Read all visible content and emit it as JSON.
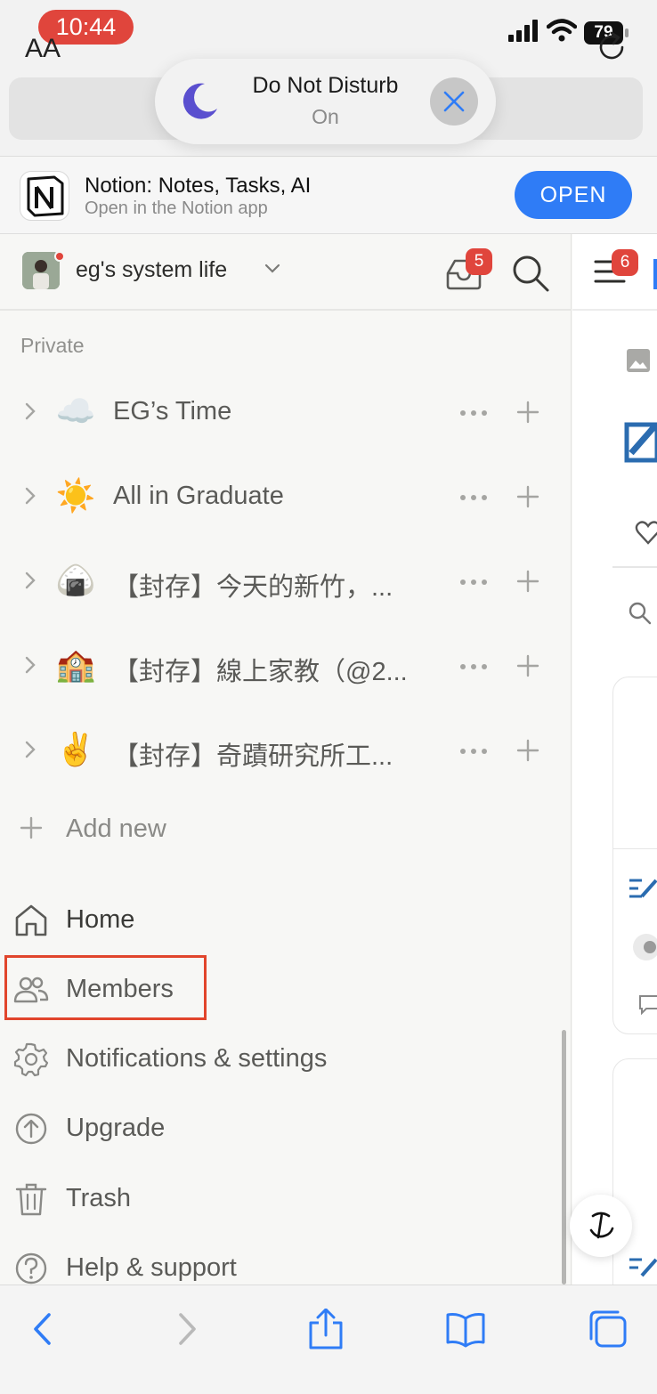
{
  "status_bar": {
    "time": "10:44",
    "battery": "79"
  },
  "browser": {
    "text_size_label": "AA"
  },
  "dnd": {
    "title": "Do Not Disturb",
    "status": "On"
  },
  "app_banner": {
    "title": "Notion: Notes, Tasks, AI",
    "subtitle": "Open in the Notion app",
    "open_label": "OPEN"
  },
  "workspace": {
    "name": "eg's system life",
    "inbox_count": "5",
    "menu_count": "6"
  },
  "sidebar": {
    "section_label": "Private",
    "pages": [
      {
        "emoji": "☁️",
        "title": "EG’s Time"
      },
      {
        "emoji": "☀️",
        "title": "All in Graduate"
      },
      {
        "emoji": "🍙",
        "title": "【封存】今天的新竹，..."
      },
      {
        "emoji": "🏫",
        "title": "【封存】線上家教（@2..."
      },
      {
        "emoji": "✌️",
        "title": "【封存】奇蹟研究所工..."
      }
    ],
    "add_new_label": "Add new",
    "nav": [
      {
        "label": "Home"
      },
      {
        "label": "Members"
      },
      {
        "label": "Notifications & settings"
      },
      {
        "label": "Upgrade"
      },
      {
        "label": "Trash"
      },
      {
        "label": "Help & support"
      }
    ]
  }
}
